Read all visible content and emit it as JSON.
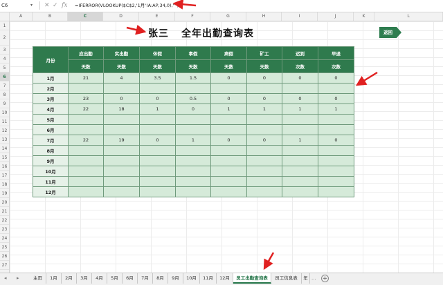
{
  "formula_bar": {
    "name_box": "C6",
    "cancel_icon": "✕",
    "confirm_icon": "✓",
    "fx_label": "fx",
    "formula": "=IFERROR(VLOOKUP($C$2,'1月'!A:AP,34,0),\"\")"
  },
  "columns": [
    "A",
    "B",
    "C",
    "D",
    "E",
    "F",
    "G",
    "H",
    "I",
    "J",
    "K",
    "L"
  ],
  "selected_column": "C",
  "rows": [
    "1",
    "2",
    "3",
    "4",
    "5",
    "6",
    "7",
    "8",
    "9",
    "10",
    "11",
    "12",
    "13",
    "14",
    "15",
    "16",
    "17",
    "18",
    "19",
    "20",
    "21",
    "22",
    "23",
    "24",
    "25",
    "26",
    "27"
  ],
  "selected_row": "6",
  "sheet": {
    "title_name": "张三",
    "title_text": "全年出勤查询表",
    "back_button": "返回"
  },
  "table": {
    "month_header": "月份",
    "headers": [
      {
        "top": "应出勤",
        "unit": "天数"
      },
      {
        "top": "实出勤",
        "unit": "天数"
      },
      {
        "top": "休假",
        "unit": "天数"
      },
      {
        "top": "事假",
        "unit": "天数"
      },
      {
        "top": "病假",
        "unit": "天数"
      },
      {
        "top": "矿工",
        "unit": "天数"
      },
      {
        "top": "迟到",
        "unit": "次数"
      },
      {
        "top": "早退",
        "unit": "次数"
      }
    ],
    "rows": [
      {
        "month": "1月",
        "values": [
          "21",
          "4",
          "3.5",
          "1.5",
          "0",
          "0",
          "0",
          "0"
        ]
      },
      {
        "month": "2月",
        "values": [
          "",
          "",
          "",
          "",
          "",
          "",
          "",
          ""
        ]
      },
      {
        "month": "3月",
        "values": [
          "23",
          "0",
          "0",
          "0.5",
          "0",
          "0",
          "0",
          "0"
        ]
      },
      {
        "month": "4月",
        "values": [
          "22",
          "18",
          "1",
          "0",
          "1",
          "1",
          "1",
          "1"
        ]
      },
      {
        "month": "5月",
        "values": [
          "",
          "",
          "",
          "",
          "",
          "",
          "",
          ""
        ]
      },
      {
        "month": "6月",
        "values": [
          "",
          "",
          "",
          "",
          "",
          "",
          "",
          ""
        ]
      },
      {
        "month": "7月",
        "values": [
          "22",
          "19",
          "0",
          "1",
          "0",
          "0",
          "1",
          "0"
        ]
      },
      {
        "month": "8月",
        "values": [
          "",
          "",
          "",
          "",
          "",
          "",
          "",
          ""
        ]
      },
      {
        "month": "9月",
        "values": [
          "",
          "",
          "",
          "",
          "",
          "",
          "",
          ""
        ]
      },
      {
        "month": "10月",
        "values": [
          "",
          "",
          "",
          "",
          "",
          "",
          "",
          ""
        ]
      },
      {
        "month": "11月",
        "values": [
          "",
          "",
          "",
          "",
          "",
          "",
          "",
          ""
        ]
      },
      {
        "month": "12月",
        "values": [
          "",
          "",
          "",
          "",
          "",
          "",
          "",
          ""
        ]
      }
    ]
  },
  "sheet_tabs": [
    "主页",
    "1月",
    "2月",
    "3月",
    "4月",
    "5月",
    "6月",
    "7月",
    "8月",
    "9月",
    "10月",
    "11月",
    "12月",
    "员工出勤查询表",
    "员工信息表",
    "年"
  ],
  "active_tab": "员工出勤查询表",
  "tab_overflow": "...",
  "add_tab_icon": "+",
  "nav_prev": "◂",
  "nav_next": "▸",
  "colors": {
    "header_green": "#2f7a4d",
    "cell_green": "#d5ead9",
    "arrow_red": "#e02020",
    "accent": "#217346"
  }
}
